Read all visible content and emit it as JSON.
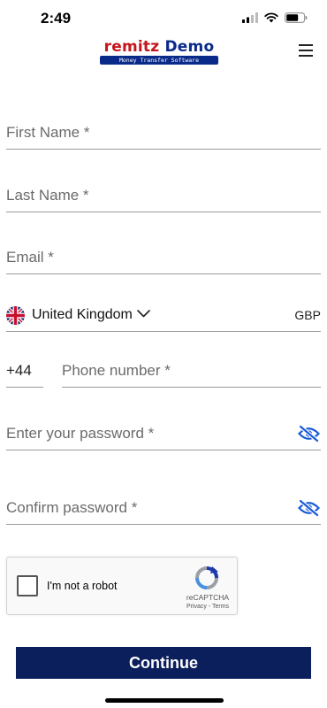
{
  "status": {
    "time": "2:49"
  },
  "header": {
    "logo_brand": "remitz",
    "logo_demo": "Demo",
    "logo_tagline": "Money Transfer Software"
  },
  "form": {
    "first_name_placeholder": "First Name *",
    "last_name_placeholder": "Last Name *",
    "email_placeholder": "Email *",
    "country": "United Kingdom",
    "currency": "GBP",
    "dial_code": "+44",
    "phone_placeholder": "Phone number *",
    "password_placeholder": "Enter your password *",
    "confirm_password_placeholder": "Confirm password *"
  },
  "recaptcha": {
    "label": "I'm not a robot",
    "brand": "reCAPTCHA",
    "privacy": "Privacy",
    "separator": " - ",
    "terms": "Terms"
  },
  "actions": {
    "continue_label": "Continue"
  },
  "colors": {
    "primary_button": "#0b1f5c",
    "logo_red": "#c4161c",
    "logo_blue": "#0a2a8a",
    "eye_icon": "#1a5bd8"
  },
  "icons": {
    "flag": "uk-flag-icon",
    "country_dropdown": "chevron-down-icon",
    "password_visibility": "eye-off-icon",
    "menu": "hamburger-menu-icon"
  }
}
